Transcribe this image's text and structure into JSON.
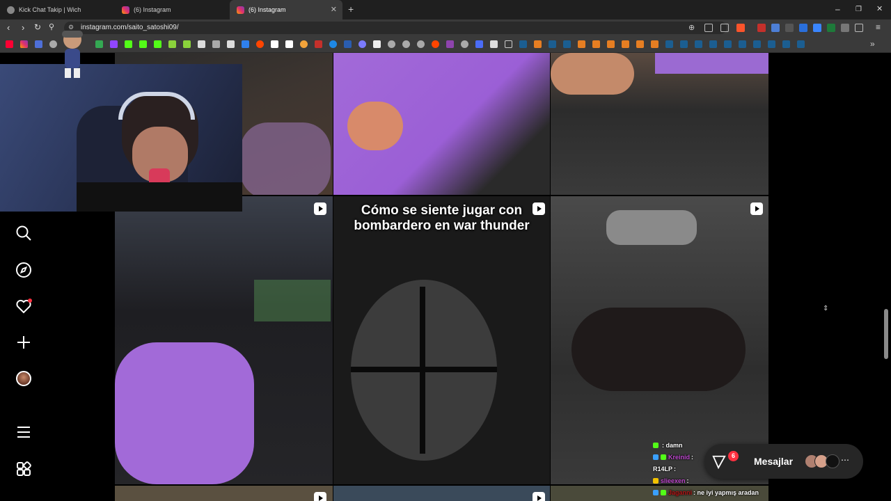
{
  "browser": {
    "tabs": [
      {
        "title": "Kick Chat Takip | Wich",
        "active": false
      },
      {
        "title": "(6) Instagram",
        "active": false
      },
      {
        "title": "(6) Instagram",
        "active": true
      }
    ],
    "new_tab": "+",
    "url": "instagram.com/saito_satoshi09/",
    "window_controls": {
      "minimize": "–",
      "restore": "❐",
      "close": "✕"
    }
  },
  "instagram": {
    "nav_icons": [
      "search-icon",
      "explore-icon",
      "notifications-icon",
      "create-icon",
      "profile-avatar",
      "more-menu-icon",
      "also-from-meta-icon"
    ],
    "posts": [
      {
        "caption": ""
      },
      {
        "caption": ""
      },
      {
        "caption": ""
      },
      {
        "caption": ""
      },
      {
        "caption": "Cómo se siente jugar con bombardero en war thunder"
      },
      {
        "caption": ""
      }
    ],
    "messages": {
      "label": "Mesajlar",
      "badge": "6"
    }
  },
  "chat": [
    {
      "user": "",
      "text": ": damn",
      "color": "#b91818"
    },
    {
      "user": "Kreinid",
      "text": ":",
      "color": "#c04ad0"
    },
    {
      "user": "R14LP",
      "text": ":",
      "color": "#ffffff"
    },
    {
      "user": "slieexen",
      "text": ":",
      "color": "#c04ad0"
    },
    {
      "user": "Jaganni",
      "text": ": ne iyi yapmış aradan",
      "color": "#b91818"
    }
  ],
  "colors": {
    "accent": "#0095f6",
    "badge": "#ff3040",
    "chrome_bg": "#3a3a3a"
  }
}
